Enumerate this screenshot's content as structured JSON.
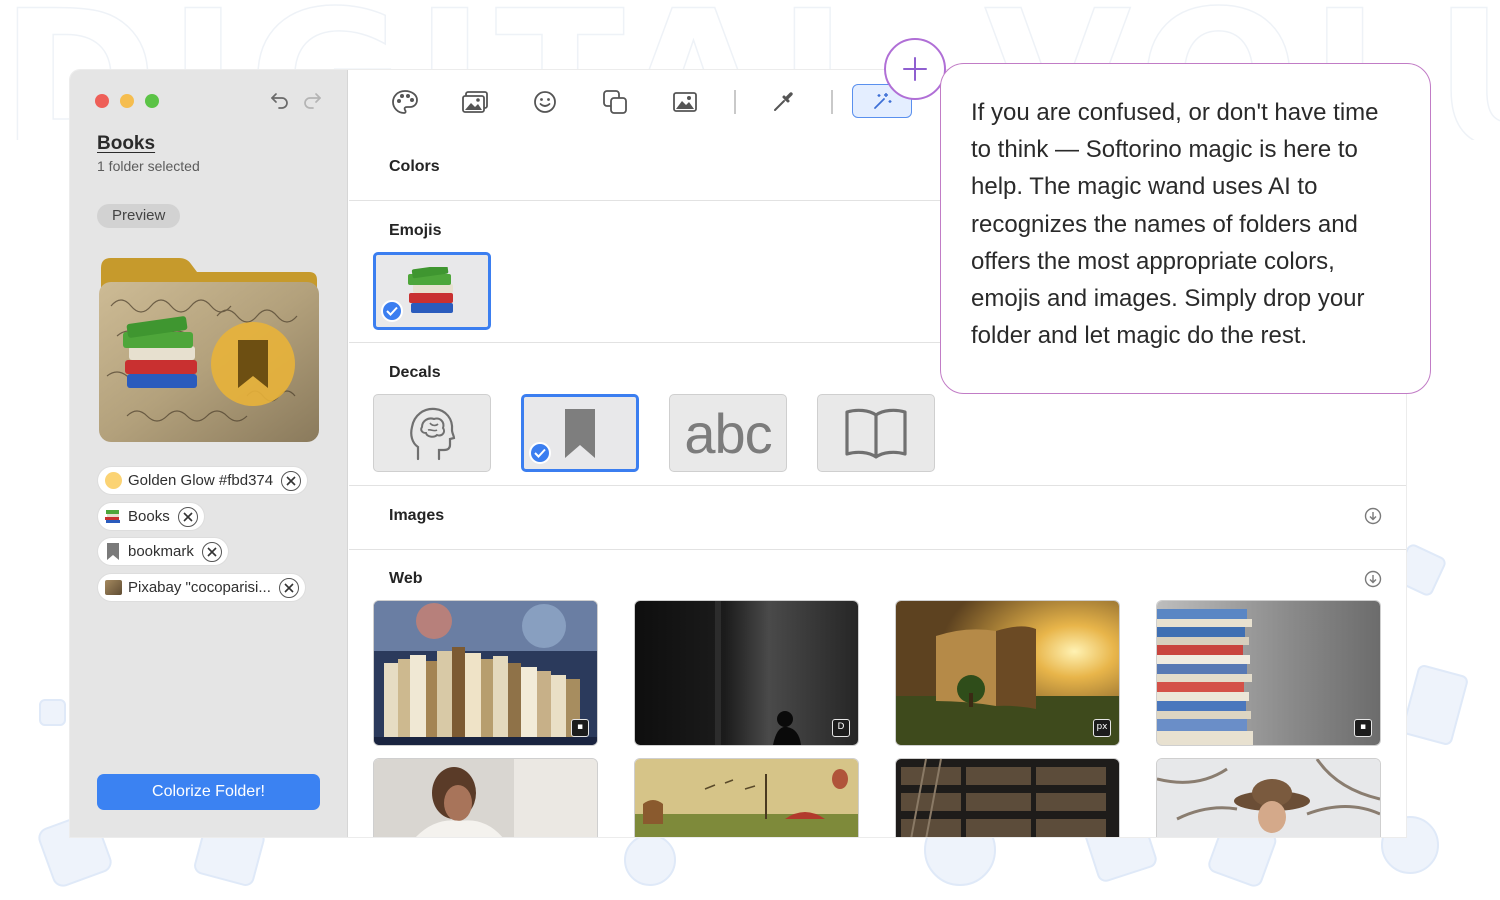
{
  "sidebar": {
    "folder_name": "Books",
    "folder_sub": "1 folder selected",
    "preview_label": "Preview",
    "chips": [
      {
        "label": "Golden Glow #fbd374",
        "swatch": "#fbd374"
      },
      {
        "label": "Books",
        "icon": "books-emoji"
      },
      {
        "label": "bookmark",
        "icon": "bookmark-icon"
      },
      {
        "label": "Pixabay \"cocoparisi...",
        "icon": "image-thumbnail"
      }
    ],
    "colorize_label": "Colorize Folder!"
  },
  "toolbar": {
    "icons": [
      "palette-icon",
      "images-icon",
      "emoji-icon",
      "shapes-icon",
      "image-icon",
      "eyedropper-icon",
      "magic-wand-icon"
    ],
    "active": "magic-wand-icon"
  },
  "sections": {
    "colors": "Colors",
    "emojis": "Emojis",
    "decals": "Decals",
    "images": "Images",
    "web": "Web"
  },
  "decals": [
    {
      "icon": "brain-head-icon",
      "selected": false
    },
    {
      "icon": "bookmark-icon",
      "selected": true
    },
    {
      "text": "abc",
      "selected": false
    },
    {
      "icon": "open-book-icon",
      "selected": false
    }
  ],
  "web_images": [
    {
      "subject": "books on shelf",
      "badge": "unsplash"
    },
    {
      "subject": "dark room silhouette",
      "badge": "D"
    },
    {
      "subject": "giant book landscape",
      "badge": "px"
    },
    {
      "subject": "stacked books",
      "badge": "unsplash"
    },
    {
      "subject": "woman reading"
    },
    {
      "subject": "surreal book scene"
    },
    {
      "subject": "library shelves"
    },
    {
      "subject": "woman in hat outdoors"
    }
  ],
  "colors": {
    "accent": "#3b82f2",
    "folder_color": "#fbd374",
    "callout_border": "#c17cc6"
  },
  "callout": {
    "text": "If you are confused, or don't have time to think — Softorino magic is here to help. The magic wand uses AI to recognizes the names of folders and offers the most appropriate colors, emojis and images. Simply drop your folder and let magic do the rest."
  }
}
